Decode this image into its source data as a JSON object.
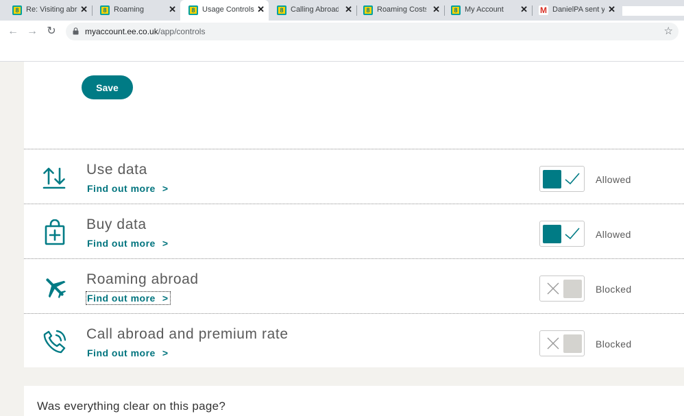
{
  "browser": {
    "tabs": [
      {
        "title": "Re: Visiting abr",
        "favicon": "ee-icon",
        "active": false
      },
      {
        "title": "Roaming",
        "favicon": "ee-icon",
        "active": false
      },
      {
        "title": "Usage Controls",
        "favicon": "ee-icon",
        "active": true
      },
      {
        "title": "Calling Abroad",
        "favicon": "ee-icon",
        "active": false
      },
      {
        "title": "Roaming Costs",
        "favicon": "ee-icon",
        "active": false
      },
      {
        "title": "My Account",
        "favicon": "ee-icon",
        "active": false
      },
      {
        "title": "DanielPA sent y",
        "favicon": "gmail-icon",
        "active": false
      }
    ],
    "close_glyph": "✕",
    "ee_favicon_glyph": "8",
    "gmail_favicon_glyph": "M",
    "nav": {
      "back": "←",
      "forward": "→",
      "reload": "↻",
      "star": "☆"
    },
    "url_host": "myaccount.ee.co.uk",
    "url_path": "/app/controls"
  },
  "page": {
    "save_label": "Save",
    "controls": [
      {
        "title": "Use data",
        "link": "Find out more",
        "chevron": ">",
        "status": "Allowed",
        "state": "on",
        "icon": "data-arrows-icon"
      },
      {
        "title": "Buy data",
        "link": "Find out more",
        "chevron": ">",
        "status": "Allowed",
        "state": "on",
        "icon": "shopping-bag-plus-icon"
      },
      {
        "title": "Roaming abroad",
        "link": "Find out more",
        "chevron": ">",
        "status": "Blocked",
        "state": "off",
        "icon": "airplane-icon"
      },
      {
        "title": "Call abroad and premium rate",
        "link": "Find out more",
        "chevron": ">",
        "status": "Blocked",
        "state": "off",
        "icon": "phone-call-icon"
      }
    ],
    "feedback_question": "Was everything clear on this page?"
  },
  "colors": {
    "brand_teal": "#007b85",
    "link_teal": "#00747e",
    "toggle_off_knob": "#d4d3cf",
    "page_bg": "#f3f2ee"
  }
}
